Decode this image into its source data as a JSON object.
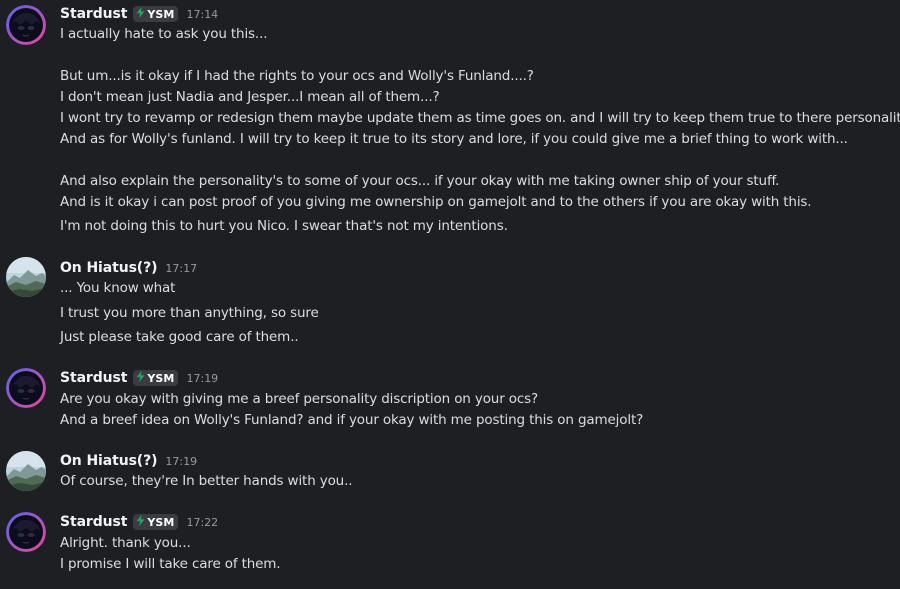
{
  "messages": [
    {
      "author": "Stardust",
      "tag": "YSM",
      "time": "17:14",
      "lines": [
        "I actually hate to ask you this...",
        "But um...is it okay if I had the rights to your ocs and Wolly's Funland....?",
        "I don't mean just Nadia and Jesper...I mean all of them...?",
        "I wont try to revamp or redesign them maybe update them as time goes on. and I will try to keep them true to there personalities.",
        "And as for Wolly's funland. I will try to keep it true to its story and lore, if you could give me a brief thing to work with...",
        "And also explain the personality's to some of your ocs... if your okay with me taking owner ship of your stuff.",
        "And is it okay i can post proof of you giving me ownership on gamejolt and to the others if you are okay with this.",
        "I'm not doing this to hurt you Nico. I swear that's not my intentions."
      ]
    },
    {
      "author": "On Hiatus(?)",
      "time": "17:17",
      "lines": [
        "... You know what",
        "I trust you more than anything, so sure",
        "Just please take good care of them.."
      ]
    },
    {
      "author": "Stardust",
      "tag": "YSM",
      "time": "17:19",
      "lines": [
        "Are you okay with giving me a breef personality discription on your ocs?",
        "And a breef idea on Wolly's Funland? and if your okay with me posting this on gamejolt?"
      ]
    },
    {
      "author": "On Hiatus(?)",
      "time": "17:19",
      "lines": [
        "Of course, they're In better hands with you.."
      ]
    },
    {
      "author": "Stardust",
      "tag": "YSM",
      "time": "17:22",
      "lines": [
        "Alright. thank you...",
        "I promise I will take care of them."
      ]
    }
  ],
  "icons": {
    "tag_icon": "lightning-bolt-icon",
    "avatar_stardust": "anime-avatar-icon",
    "avatar_hiatus": "landscape-avatar-icon"
  },
  "colors": {
    "background": "#1e1f22",
    "username": "#f2f3f5",
    "text": "#dbdee1",
    "timestamp": "#949ba4",
    "tag_bg": "#3a3c42",
    "bolt": "#23a55a",
    "avatar_ring_blue": "#5865f2",
    "avatar_ring_pink": "#eb459e"
  }
}
